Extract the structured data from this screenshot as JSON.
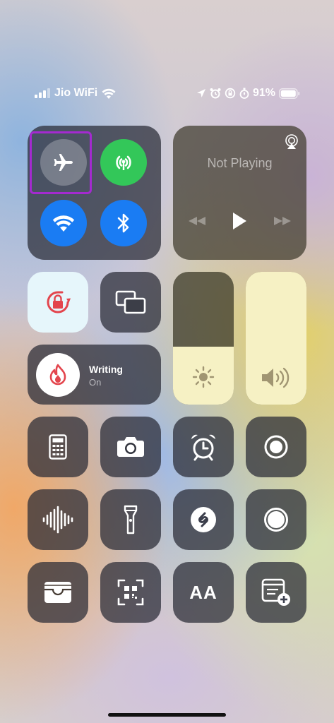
{
  "status": {
    "carrier": "Jio WiFi",
    "battery": "91%"
  },
  "media": {
    "title": "Not Playing"
  },
  "focus": {
    "label": "Writing",
    "state": "On"
  },
  "text_size_glyph": "AA",
  "colors": {
    "cellular": "#33c759",
    "wifi": "#1a7cf3",
    "bluetooth": "#1a7cf3",
    "highlight": "#a42ad0",
    "lock_red": "#e3454d"
  }
}
